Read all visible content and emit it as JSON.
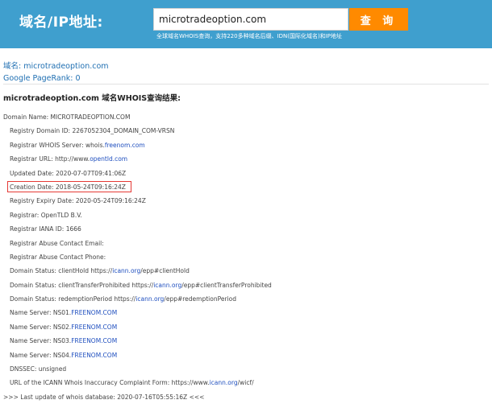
{
  "header": {
    "label": "域名/IP地址:",
    "search_value": "microtradeoption.com",
    "search_button": "查 询",
    "subtitle": "全球域名WHOIS查询，支持220多种域名后缀、IDN(国际化域名)和IP地址"
  },
  "info": {
    "domain_line": "域名: microtradeoption.com",
    "pagerank_line": "Google PageRank: 0"
  },
  "result_heading": "microtradeoption.com 域名WHOIS查询结果:",
  "whois": {
    "domain_name": "Domain Name: MICROTRADEOPTION.COM",
    "registry_domain_id": "Registry Domain ID: 2267052304_DOMAIN_COM-VRSN",
    "registrar_whois_prefix": "Registrar WHOIS Server: whois.",
    "registrar_whois_link": "freenom.com",
    "registrar_url_prefix": "Registrar URL: http://www.",
    "registrar_url_link": "opentld.com",
    "updated_date": "Updated Date: 2020-07-07T09:41:06Z",
    "creation_date": "Creation Date: 2018-05-24T09:16:24Z",
    "expiry_date": "Registry Expiry Date: 2020-05-24T09:16:24Z",
    "registrar": "Registrar: OpenTLD B.V.",
    "iana_id": "Registrar IANA ID: 1666",
    "abuse_email": "Registrar Abuse Contact Email:",
    "abuse_phone": "Registrar Abuse Contact Phone:",
    "status1_prefix": "Domain Status: clientHold https://",
    "status1_link": "icann.org",
    "status1_suffix": "/epp#clientHold",
    "status2_prefix": "Domain Status: clientTransferProhibited https://",
    "status2_link": "icann.org",
    "status2_suffix": "/epp#clientTransferProhibited",
    "status3_prefix": "Domain Status: redemptionPeriod https://",
    "status3_link": "icann.org",
    "status3_suffix": "/epp#redemptionPeriod",
    "ns_prefix_1": "Name Server: NS01.",
    "ns_link_1": "FREENOM.COM",
    "ns_prefix_2": "Name Server: NS02.",
    "ns_link_2": "FREENOM.COM",
    "ns_prefix_3": "Name Server: NS03.",
    "ns_link_3": "FREENOM.COM",
    "ns_prefix_4": "Name Server: NS04.",
    "ns_link_4": "FREENOM.COM",
    "dnssec": "DNSSEC: unsigned",
    "icann_form_prefix": "URL of the ICANN Whois Inaccuracy Complaint Form: https://www.",
    "icann_form_link": "icann.org",
    "icann_form_suffix": "/wicf/",
    "last_update": ">>> Last update of whois database: 2020-07-16T05:55:16Z <<<"
  },
  "colors": {
    "header_bg": "#3f9fce",
    "button_bg": "#ff8a00",
    "link": "#1f4fbf",
    "highlight": "#e53935"
  }
}
